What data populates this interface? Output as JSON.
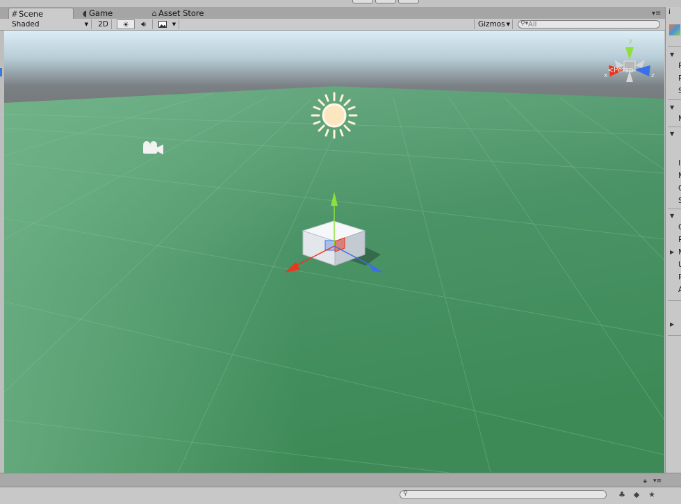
{
  "tabs": [
    {
      "label": "Scene",
      "icon": "grid-icon",
      "active": true
    },
    {
      "label": "Game",
      "icon": "pacman-icon",
      "active": false
    },
    {
      "label": "Asset Store",
      "icon": "store-icon",
      "active": false
    }
  ],
  "scene_toolbar": {
    "shading_mode": "Shaded",
    "mode_2d_label": "2D",
    "gizmos_label": "Gizmos",
    "search_placeholder": "All"
  },
  "viewport": {
    "projection_label": "Persp",
    "axis_labels": {
      "x": "x",
      "y": "y",
      "z": "z"
    },
    "colors": {
      "sky": "#dcedf5",
      "ground": "#4f9a68",
      "x_axis": "#e8371f",
      "y_axis": "#8fe03a",
      "z_axis": "#3a6fe8"
    }
  },
  "inspector_letters": [
    "P",
    "R",
    "S",
    "M",
    "I",
    "M",
    "C",
    "S",
    "C",
    "R",
    "M",
    "U",
    "R",
    "A"
  ],
  "bottom": {
    "search_placeholder": ""
  }
}
